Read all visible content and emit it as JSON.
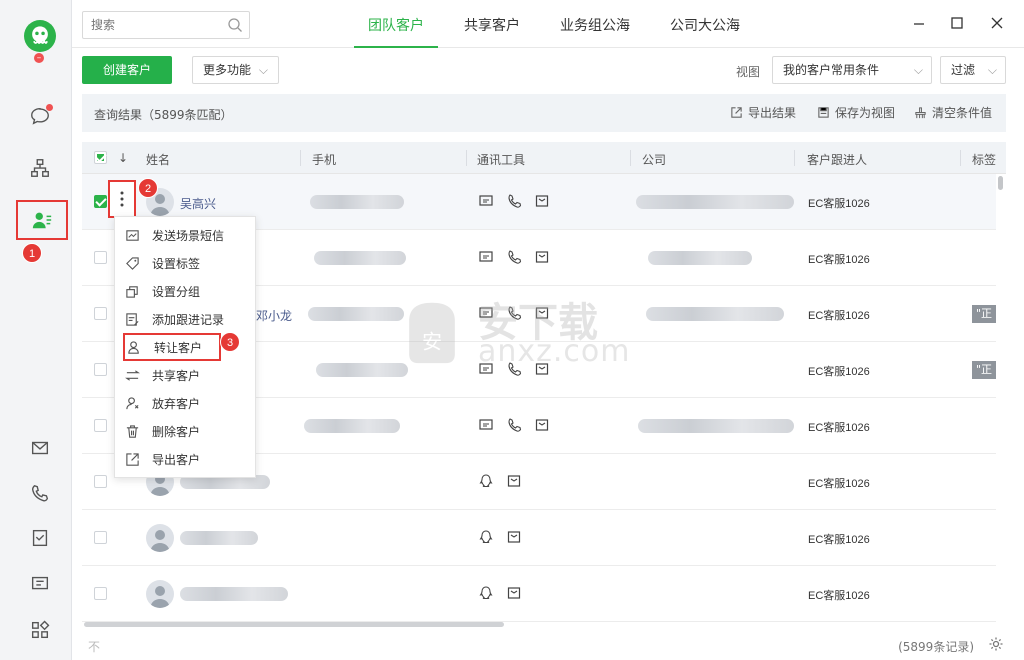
{
  "sidebar": {
    "badges": [
      "1"
    ]
  },
  "search": {
    "placeholder": "搜索"
  },
  "tabs": [
    {
      "label": "团队客户",
      "active": true
    },
    {
      "label": "共享客户"
    },
    {
      "label": "业务组公海"
    },
    {
      "label": "公司大公海"
    }
  ],
  "toolbar": {
    "create_label": "创建客户",
    "more_label": "更多功能",
    "view_label": "视图",
    "view_value": "我的客户常用条件",
    "filter_label": "过滤"
  },
  "result": {
    "summary": "查询结果（5899条匹配）",
    "export": "导出结果",
    "save_view": "保存为视图",
    "clear": "清空条件值"
  },
  "columns": [
    "姓名",
    "手机",
    "通讯工具",
    "公司",
    "客户跟进人",
    "标签"
  ],
  "rows": [
    {
      "name": "吴高兴",
      "follower": "EC客服1026",
      "tag": "",
      "checked": true
    },
    {
      "name": "",
      "follower": "EC客服1026",
      "tag": ""
    },
    {
      "name": "邓小龙",
      "follower": "EC客服1026",
      "tag": "\"正"
    },
    {
      "name": "",
      "follower": "EC客服1026",
      "tag": "\"正"
    },
    {
      "name": "",
      "follower": "EC客服1026",
      "tag": ""
    },
    {
      "name": "",
      "follower": "EC客服1026",
      "tag": ""
    },
    {
      "name": "",
      "follower": "EC客服1026",
      "tag": ""
    },
    {
      "name": "",
      "follower": "EC客服1026",
      "tag": ""
    }
  ],
  "menu": [
    {
      "label": "发送场景短信",
      "icon": "sms-icon"
    },
    {
      "label": "设置标签",
      "icon": "tag-icon"
    },
    {
      "label": "设置分组",
      "icon": "group-icon"
    },
    {
      "label": "添加跟进记录",
      "icon": "edit-record-icon"
    },
    {
      "label": "转让客户",
      "icon": "transfer-user-icon"
    },
    {
      "label": "共享客户",
      "icon": "share-arrows-icon"
    },
    {
      "label": "放弃客户",
      "icon": "abandon-user-icon"
    },
    {
      "label": "删除客户",
      "icon": "trash-icon"
    },
    {
      "label": "导出客户",
      "icon": "export-icon"
    }
  ],
  "annotations": {
    "step1": "1",
    "step2": "2",
    "step3": "3"
  },
  "footer": {
    "left": "不",
    "count": "(5899条记录)"
  },
  "watermark": {
    "cn": "安下载",
    "en": "anxz.com"
  },
  "colors": {
    "brand": "#2cb34a",
    "highlight": "#e53935"
  }
}
